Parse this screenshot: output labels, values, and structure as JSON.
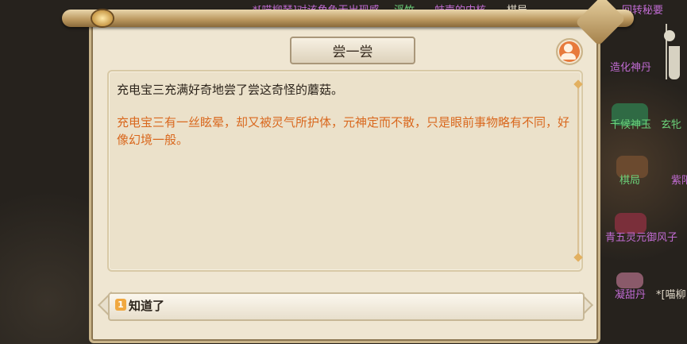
{
  "dialog": {
    "title": "尝一尝",
    "line1": "充电宝三充满好奇地尝了尝这奇怪的蘑菇。",
    "line2": "充电宝三有一丝眩晕，却又被灵气所护体，元神定而不散，只是眼前事物略有不同，好像幻境一般。"
  },
  "choices": [
    {
      "number": "1",
      "label": "知道了"
    }
  ],
  "background_labels": {
    "top_1": "*[喵柳琴]对该角色无出现感",
    "top_2": "浮竹",
    "top_3": "蚌壳的内核",
    "top_4": "棋局",
    "top_5": "回转秘要",
    "right_1": "造化神丹",
    "right_2": "千候神玉",
    "right_3": "玄牝",
    "right_4": "棋局",
    "right_5": "紫阳",
    "right_6": "青五灵元御风子",
    "right_7": "凝甜丹",
    "right_8": "*[喵柳"
  },
  "colors": {
    "accent_orange": "#d9681e",
    "parchment": "#efe6d2",
    "gold": "#c9b48a"
  }
}
